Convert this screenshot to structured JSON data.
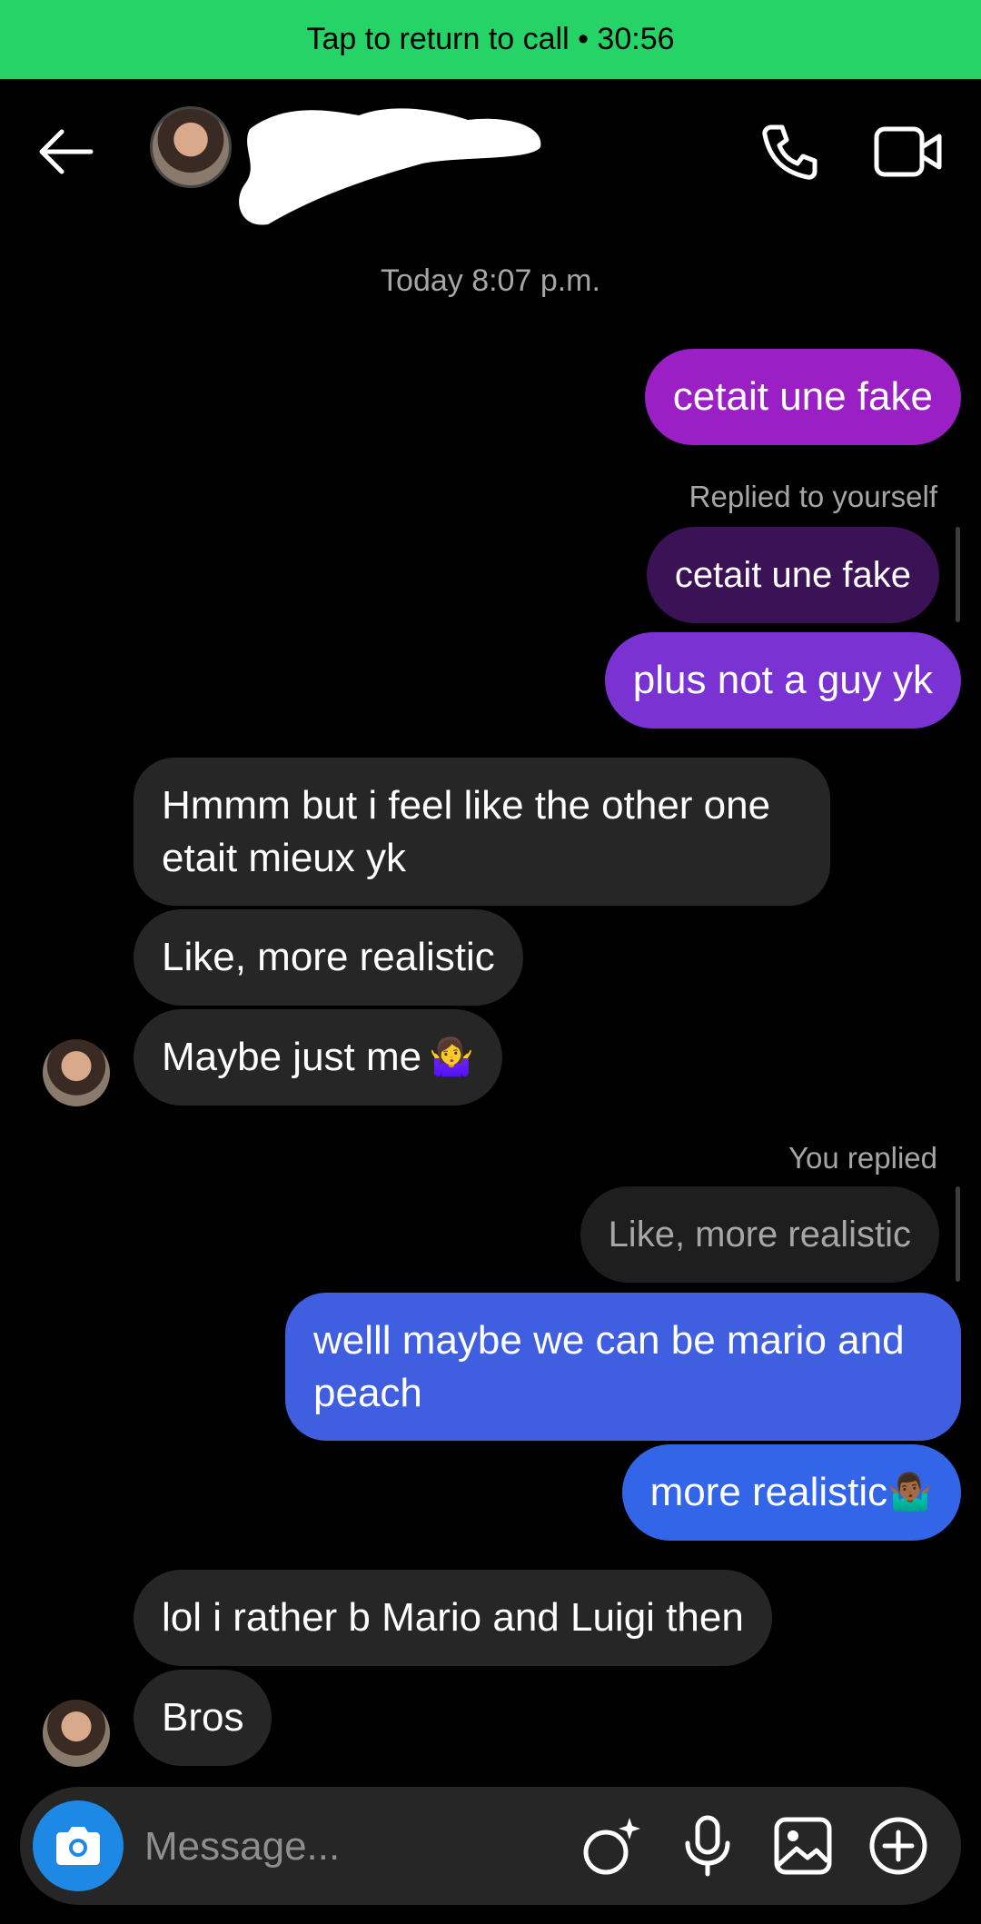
{
  "call_bar": {
    "text": "Tap to return to call • 30:56",
    "color": "#25d366"
  },
  "header": {
    "back_icon": "arrow-left-icon",
    "contact_name_redacted": true,
    "phone_icon": "phone-icon",
    "video_icon": "video-camera-icon"
  },
  "timestamp": "Today 8:07 p.m.",
  "messages": {
    "m1": "cetait une fake",
    "reply_label_1": "Replied to yourself",
    "reply_quote_1": "cetait une fake",
    "m2": "plus not a guy yk",
    "r1": "Hmmm but i feel like the other one etait mieux yk",
    "r2": "Like, more realistic",
    "r3": "Maybe just me",
    "r3_emoji": "🤷‍♀️",
    "reply_label_2": "You replied",
    "reply_quote_2": "Like, more realistic",
    "m3": "welll maybe we can be mario and peach",
    "m4": "more realistic",
    "m4_emoji": "🤷🏾‍♂️",
    "r4": "lol i rather b Mario and Luigi then",
    "r5": "Bros"
  },
  "composer": {
    "placeholder": "Message...",
    "icons": [
      "camera-icon",
      "sticker-effects-icon",
      "microphone-icon",
      "gallery-icon",
      "plus-circle-icon"
    ]
  },
  "colors": {
    "sent_purple": "#9a1fc5",
    "sent_violet": "#7a33d2",
    "sent_blue": "#3f5fe0",
    "received": "#262626",
    "camera_button": "#1e88e5"
  }
}
